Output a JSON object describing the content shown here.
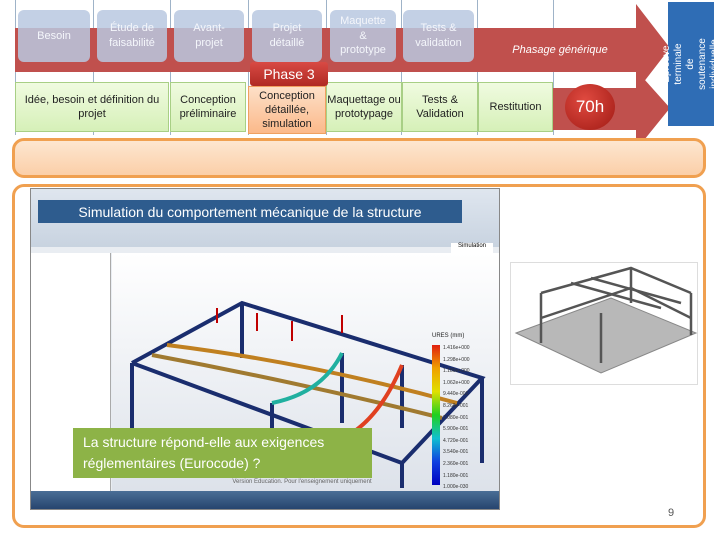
{
  "generic_phases": [
    "Besoin",
    "Étude de faisabilité",
    "Avant-projet",
    "Projet détaillé",
    "Maquette & prototype",
    "Tests & validation"
  ],
  "generic_label": "Phasage générique",
  "final_exam": "Épreuve terminale de soutenance individuelle",
  "phase_badge": "Phase 3",
  "steps": [
    "Idée, besoin et définition du projet",
    "Conception préliminaire",
    "Conception détaillée, simulation",
    "Maquettage ou prototypage",
    "Tests & Validation",
    "Restitution"
  ],
  "duration": "70h",
  "panel": {
    "title": "Simulation du comportement mécanique de la structure",
    "question": "La structure répond-elle aux exigences réglementaires (Eurocode) ?",
    "software": {
      "active_tab": "Simulation",
      "legend_title": "URES (mm)",
      "legend_values": [
        "1.416e+000",
        "1.298e+000",
        "1.180e+000",
        "1.062e+000",
        "9.440e-001",
        "8.260e-001",
        "7.080e-001",
        "5.900e-001",
        "4.720e-001",
        "3.540e-001",
        "2.360e-001",
        "1.180e-001",
        "1.000e-030"
      ],
      "watermark": "Version Education. Pour l'enseignement uniquement"
    }
  },
  "page_number": "9",
  "colors": {
    "arrow": "#c0504d",
    "phase_box": "#b9c8e1",
    "step_box": "#d6f0b8",
    "active_step": "#fbc9a0",
    "orange": "#f0a050",
    "title_banner": "#2e5c8e",
    "question_box": "#8db347",
    "exam_box": "#2f6db5"
  }
}
